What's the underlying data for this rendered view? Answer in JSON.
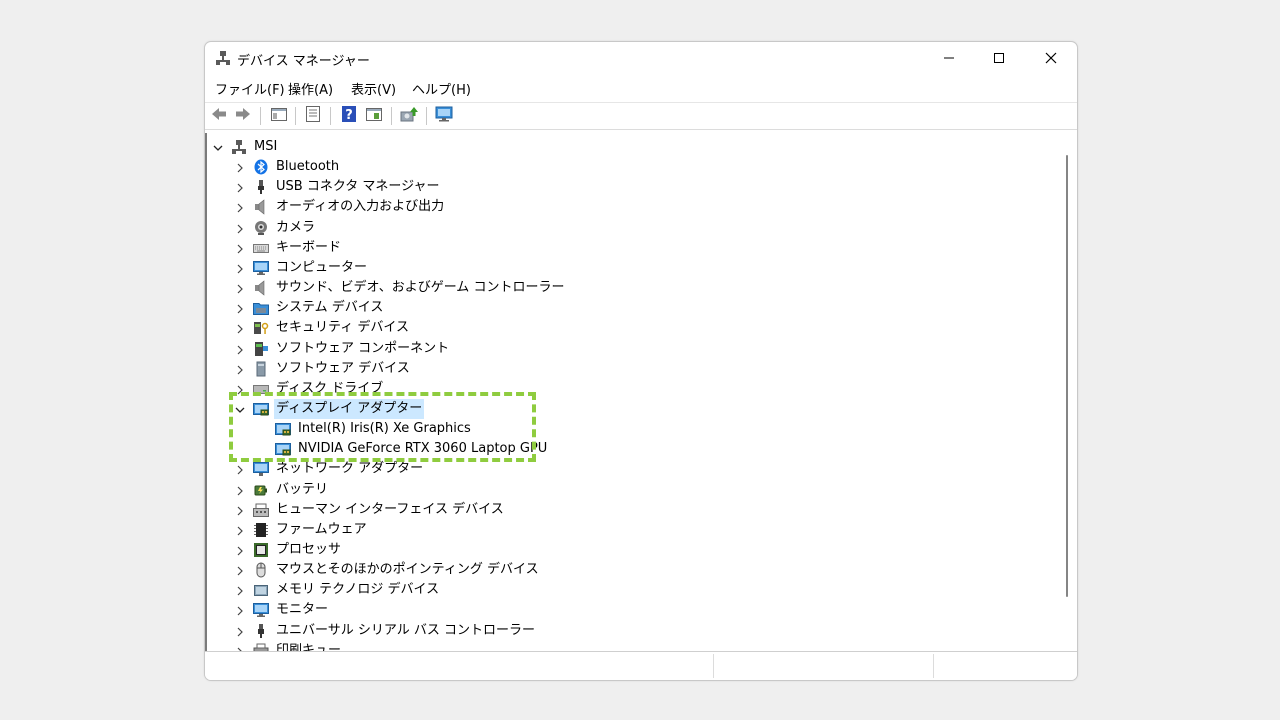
{
  "window": {
    "title": "デバイス マネージャー",
    "controls": [
      "minimize-icon",
      "maximize-icon",
      "close-icon"
    ]
  },
  "menu": [
    {
      "label": "ファイル(F)"
    },
    {
      "label": "操作(A)"
    },
    {
      "label": "表示(V)"
    },
    {
      "label": "ヘルプ(H)"
    }
  ],
  "toolbar": {
    "buttons": [
      "back-arrow-icon",
      "forward-arrow-icon",
      "show-hide-console-tree-icon",
      "properties-icon",
      "help-icon",
      "action-pane-icon",
      "update-driver-icon",
      "scan-hardware-icon"
    ]
  },
  "tree": {
    "root": {
      "label": "MSI",
      "expanded": true,
      "icon": "computer-network-icon"
    },
    "items": [
      {
        "label": "Bluetooth",
        "icon": "bluetooth-icon",
        "expanded": false
      },
      {
        "label": "USB コネクタ マネージャー",
        "icon": "usb-connector-icon",
        "expanded": false
      },
      {
        "label": "オーディオの入力および出力",
        "icon": "speaker-icon",
        "expanded": false
      },
      {
        "label": "カメラ",
        "icon": "camera-icon",
        "expanded": false
      },
      {
        "label": "キーボード",
        "icon": "keyboard-icon",
        "expanded": false
      },
      {
        "label": "コンピューター",
        "icon": "monitor-icon",
        "expanded": false
      },
      {
        "label": "サウンド、ビデオ、およびゲーム コントローラー",
        "icon": "speaker-icon",
        "expanded": false
      },
      {
        "label": "システム デバイス",
        "icon": "system-folder-icon",
        "expanded": false
      },
      {
        "label": "セキュリティ デバイス",
        "icon": "security-key-icon",
        "expanded": false
      },
      {
        "label": "ソフトウェア コンポーネント",
        "icon": "software-component-icon",
        "expanded": false
      },
      {
        "label": "ソフトウェア デバイス",
        "icon": "software-device-icon",
        "expanded": false
      },
      {
        "label": "ディスク ドライブ",
        "icon": "disk-drive-icon",
        "expanded": false
      },
      {
        "label": "ディスプレイ アダプター",
        "icon": "display-adapter-icon",
        "expanded": true,
        "selected": true,
        "children": [
          {
            "label": "Intel(R) Iris(R) Xe Graphics",
            "icon": "display-adapter-icon"
          },
          {
            "label": "NVIDIA GeForce RTX 3060 Laptop GPU",
            "icon": "display-adapter-icon"
          }
        ]
      },
      {
        "label": "ネットワーク アダプター",
        "icon": "network-adapter-icon",
        "expanded": false
      },
      {
        "label": "バッテリ",
        "icon": "battery-icon",
        "expanded": false
      },
      {
        "label": "ヒューマン インターフェイス デバイス",
        "icon": "hid-icon",
        "expanded": false
      },
      {
        "label": "ファームウェア",
        "icon": "firmware-icon",
        "expanded": false
      },
      {
        "label": "プロセッサ",
        "icon": "processor-icon",
        "expanded": false
      },
      {
        "label": "マウスとそのほかのポインティング デバイス",
        "icon": "mouse-icon",
        "expanded": false
      },
      {
        "label": "メモリ テクノロジ デバイス",
        "icon": "memory-device-icon",
        "expanded": false
      },
      {
        "label": "モニター",
        "icon": "monitor-icon",
        "expanded": false
      },
      {
        "label": "ユニバーサル シリアル バス コントローラー",
        "icon": "usb-icon",
        "expanded": false
      },
      {
        "label": "印刷キュー",
        "icon": "printer-icon",
        "expanded": false
      }
    ]
  },
  "colors": {
    "selection": "#cce8ff",
    "highlight_box": "#8fcc3f",
    "accent": "#0067c0"
  }
}
